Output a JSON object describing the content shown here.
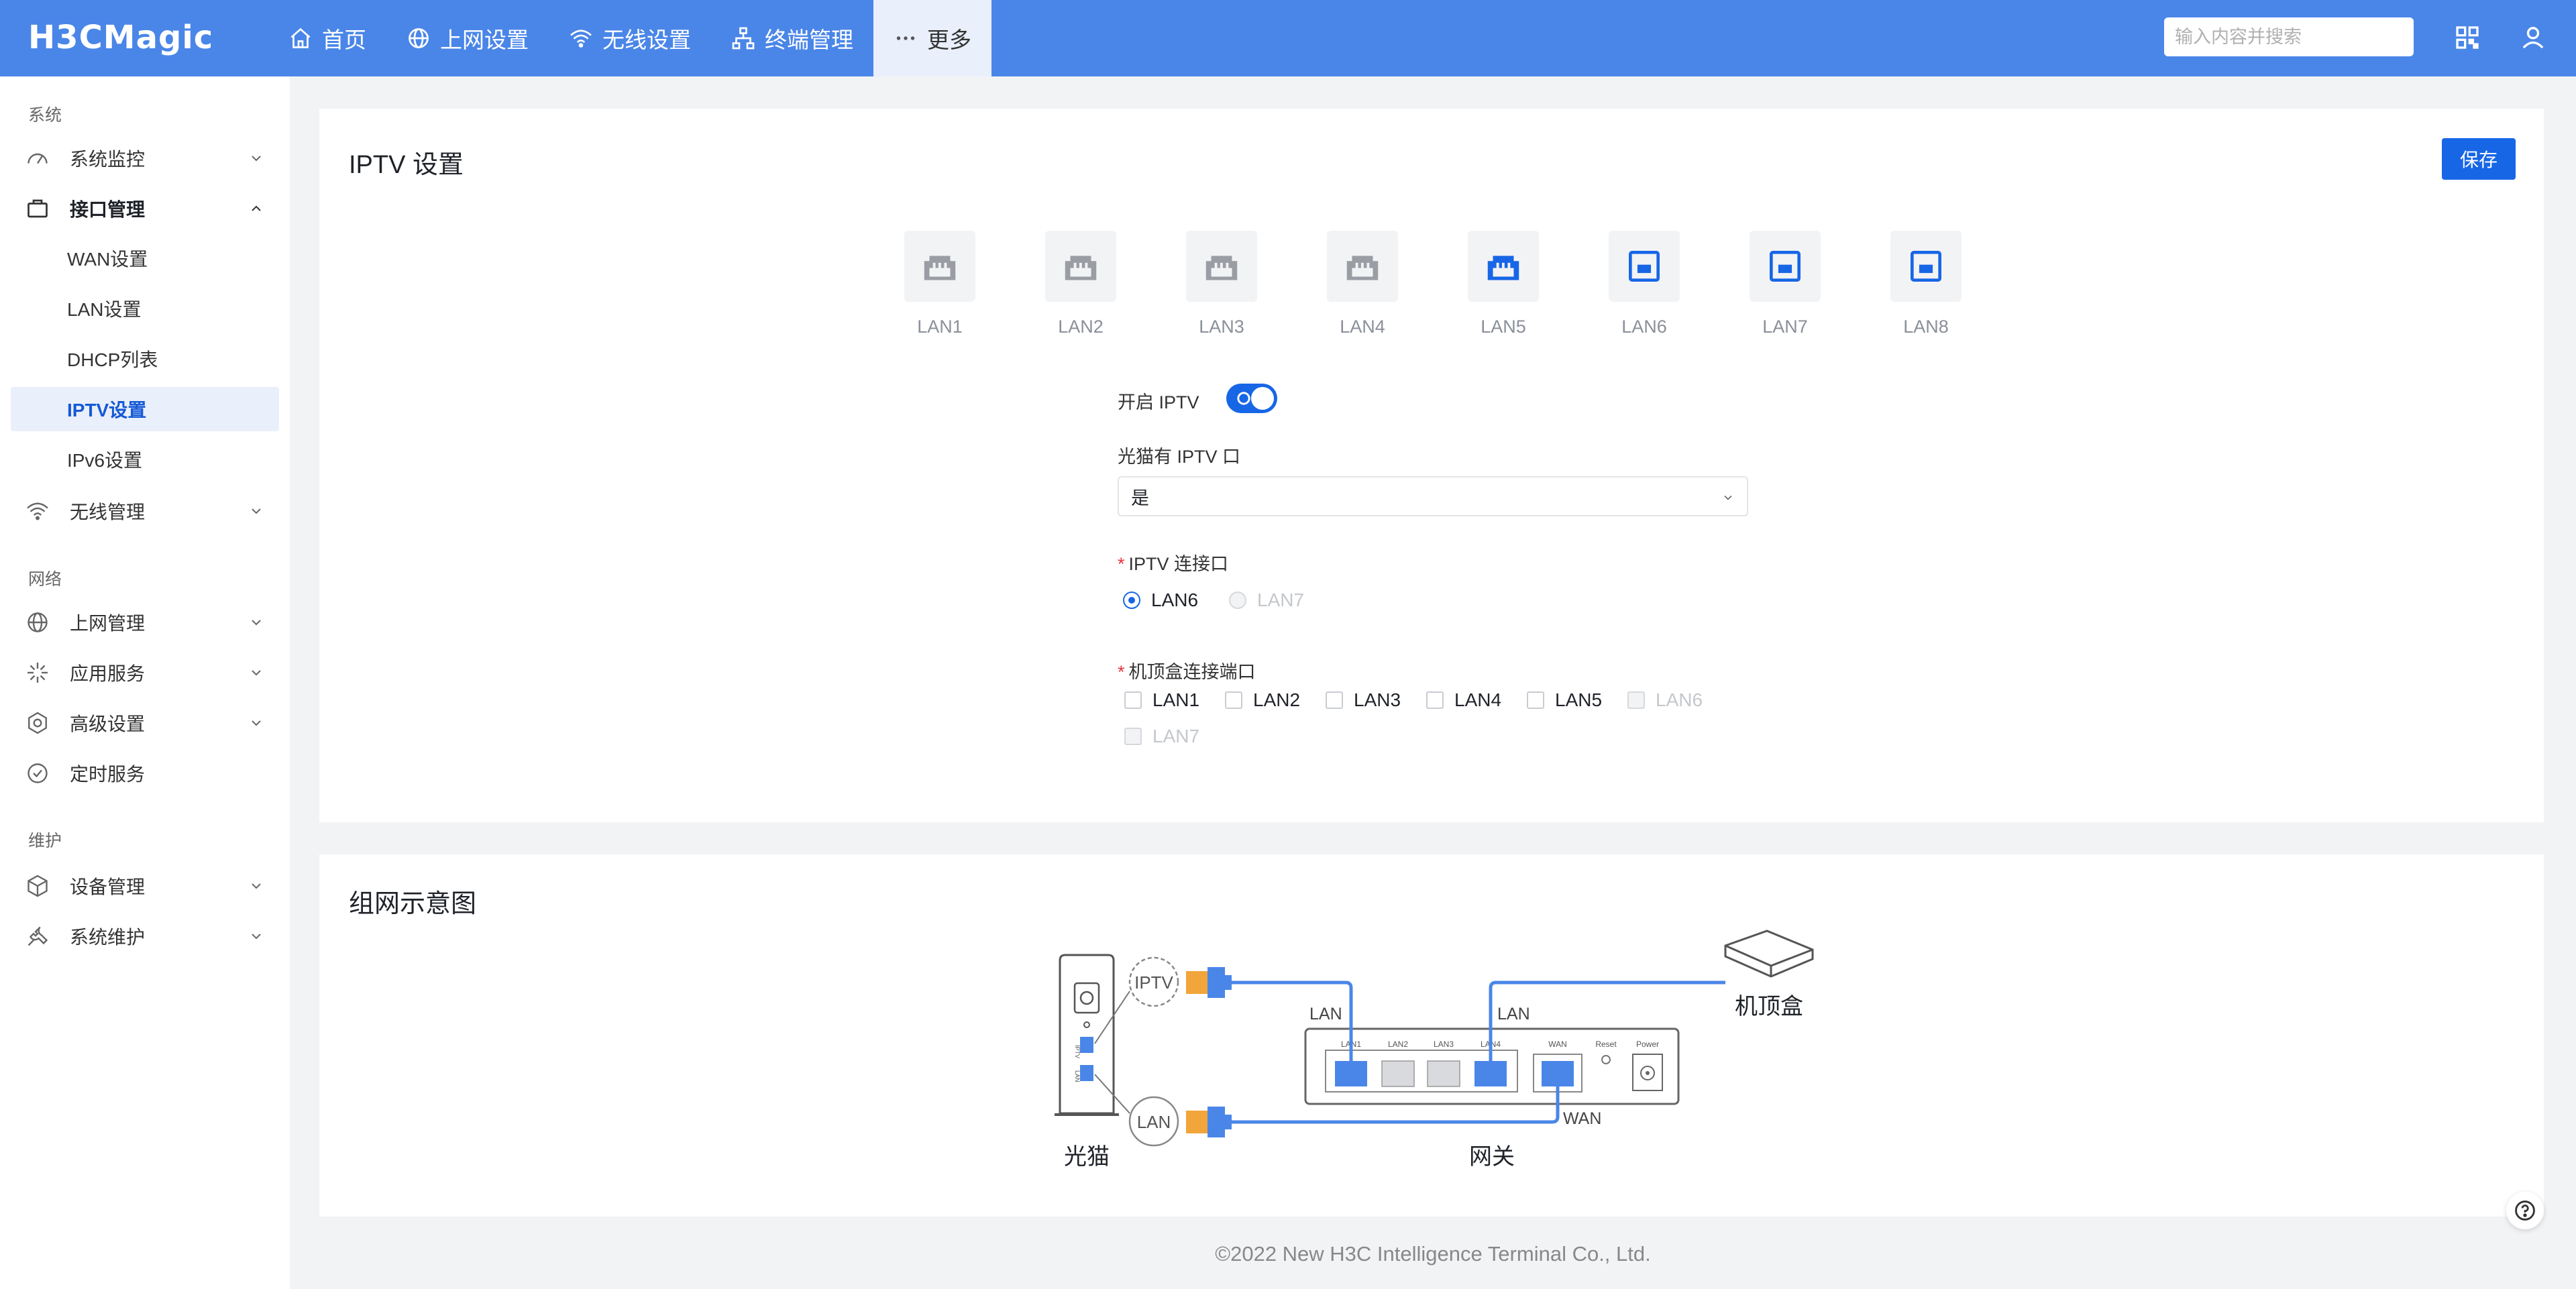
{
  "brand": {
    "logo_text": "H3CMagic",
    "accent": "#4a86e8",
    "primary": "#1766e6"
  },
  "topnav": {
    "items": [
      {
        "label": "首页",
        "icon": "home-icon"
      },
      {
        "label": "上网设置",
        "icon": "globe-icon"
      },
      {
        "label": "无线设置",
        "icon": "wifi-icon"
      },
      {
        "label": "终端管理",
        "icon": "network-icon"
      },
      {
        "label": "更多",
        "icon": "more-icon",
        "active": true
      }
    ],
    "search_placeholder": "输入内容并搜索"
  },
  "sidebar": {
    "groups": [
      {
        "label": "系统"
      },
      {
        "label": "网络"
      },
      {
        "label": "维护"
      }
    ],
    "items": [
      {
        "label": "系统监控",
        "icon": "gauge-icon"
      },
      {
        "label": "接口管理",
        "icon": "interface-icon",
        "expanded": true
      },
      {
        "label": "WAN设置"
      },
      {
        "label": "LAN设置"
      },
      {
        "label": "DHCP列表"
      },
      {
        "label": "IPTV设置",
        "active": true
      },
      {
        "label": "IPv6设置"
      },
      {
        "label": "无线管理",
        "icon": "wifi-icon"
      },
      {
        "label": "上网管理",
        "icon": "globe-icon"
      },
      {
        "label": "应用服务",
        "icon": "apps-icon"
      },
      {
        "label": "高级设置",
        "icon": "settings-icon"
      },
      {
        "label": "定时服务",
        "icon": "clock-icon"
      },
      {
        "label": "设备管理",
        "icon": "cube-icon"
      },
      {
        "label": "系统维护",
        "icon": "wrench-icon"
      }
    ]
  },
  "iptv": {
    "title": "IPTV 设置",
    "save_label": "保存",
    "ports": [
      {
        "label": "LAN1",
        "state": "inactive"
      },
      {
        "label": "LAN2",
        "state": "inactive"
      },
      {
        "label": "LAN3",
        "state": "inactive"
      },
      {
        "label": "LAN4",
        "state": "inactive"
      },
      {
        "label": "LAN5",
        "state": "connected"
      },
      {
        "label": "LAN6",
        "state": "iptv"
      },
      {
        "label": "LAN7",
        "state": "iptv"
      },
      {
        "label": "LAN8",
        "state": "iptv"
      }
    ],
    "enable_label": "开启 IPTV",
    "enable_value": true,
    "modem_label": "光猫有 IPTV 口",
    "modem_value": "是",
    "connect_label": "IPTV 连接口",
    "connect_options": [
      {
        "label": "LAN6",
        "selected": true,
        "disabled": false
      },
      {
        "label": "LAN7",
        "selected": false,
        "disabled": true
      }
    ],
    "stb_label": "机顶盒连接端口",
    "stb_options": [
      {
        "label": "LAN1",
        "disabled": false
      },
      {
        "label": "LAN2",
        "disabled": false
      },
      {
        "label": "LAN3",
        "disabled": false
      },
      {
        "label": "LAN4",
        "disabled": false
      },
      {
        "label": "LAN5",
        "disabled": false
      },
      {
        "label": "LAN6",
        "disabled": true
      },
      {
        "label": "LAN7",
        "disabled": true
      }
    ]
  },
  "topology": {
    "title": "组网示意图",
    "modem_label": "光猫",
    "gateway_label": "网关",
    "stb_label": "机顶盒",
    "bubble_iptv": "IPTV",
    "bubble_lan": "LAN",
    "cable_lan_1": "LAN",
    "cable_lan_2": "LAN",
    "cable_wan": "WAN",
    "gw_port_labels": [
      "LAN1",
      "LAN2",
      "LAN3",
      "LAN4",
      "WAN",
      "Reset",
      "Power"
    ],
    "modem_port_labels": [
      "IPTV",
      "LAN"
    ]
  },
  "footer": {
    "copyright": "©2022 New H3C Intelligence Terminal Co., Ltd."
  }
}
